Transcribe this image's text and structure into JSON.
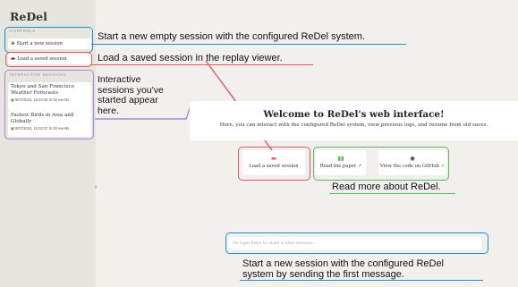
{
  "app": {
    "title": "ReDel"
  },
  "sidebar": {
    "controls_label": "CONTROLS",
    "start_new_session": "Start a new session",
    "load_saved_session": "Load a saved session",
    "interactive_label": "INTERACTIVE SESSIONS",
    "sessions": [
      {
        "title": "Tokyo and San Francisco Weather Forecasts",
        "date": "9/07/2024, 16:34:36",
        "events": "52 events"
      },
      {
        "title": "Fastest Birds in Asia and Globally",
        "date": "9/07/2024, 16:33:37",
        "events": "30 events"
      }
    ]
  },
  "main": {
    "welcome_title": "Welcome to ReDel's web interface!",
    "welcome_subtitle": "Here, you can interact with the configured ReDel system, view previous logs, and resume from old saves.",
    "buttons": {
      "load_saved": "Load a saved session",
      "read_paper": "Read the paper",
      "view_code": "View the code on GitHub"
    },
    "input_placeholder": "Or type here to start a new session..."
  },
  "annotations": {
    "start_new": "Start a new empty session with the configured ReDel system.",
    "load_saved": "Load a saved session in the replay viewer.",
    "sessions_line1": "Interactive",
    "sessions_line2": "sessions you've",
    "sessions_line3": "started appear",
    "sessions_line4": "here.",
    "read_more": "Read more about ReDel.",
    "input_line1": "Start a new session with the configured ReDel",
    "input_line2": "system by sending the first message."
  },
  "colors": {
    "blue": "#1f8ed0",
    "red": "#e25762",
    "purple": "#a58ad8",
    "green": "#5aba5a",
    "background": "#f1f0ec",
    "sidebar": "#e6e5e0"
  },
  "icons": {
    "start_new": "plus-circle-icon",
    "load_saved": "folder-icon",
    "calendar": "calendar-icon",
    "events": "list-icon",
    "book": "book-icon",
    "github": "github-icon",
    "external": "external-link-icon",
    "collapse": "chevron-left-icon"
  }
}
